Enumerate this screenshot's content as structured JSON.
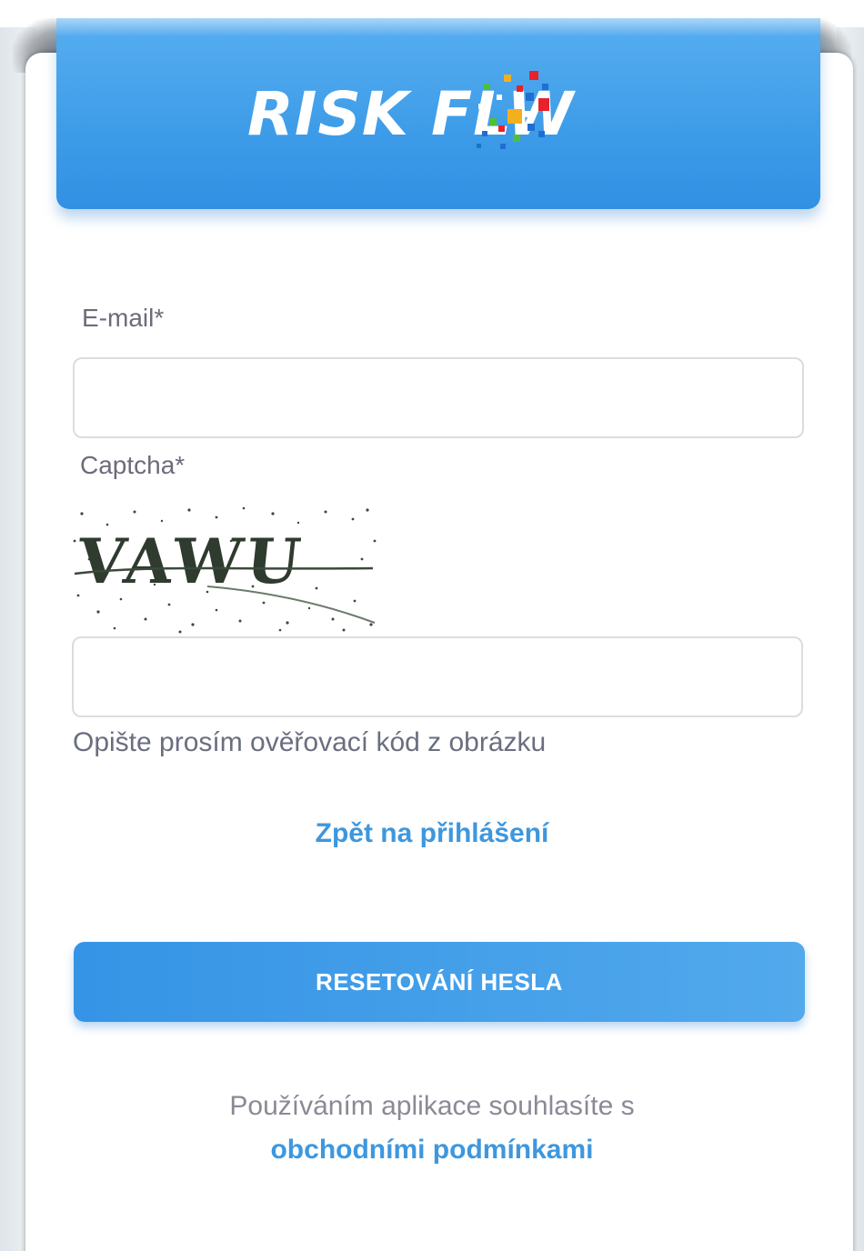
{
  "brand": {
    "logo_text": "RISK FLW",
    "logo_icon": "pixel-mosaic-o-icon",
    "header_color": "#3d9ce8"
  },
  "form": {
    "email_label": "E-mail*",
    "email_value": "",
    "captcha_label": "Captcha*",
    "captcha_image_text": "VAWU",
    "captcha_value": "",
    "captcha_hint": "Opište prosím ověřovací kód z obrázku"
  },
  "links": {
    "back_to_login": "Zpět na přihlášení"
  },
  "actions": {
    "reset_button": "RESETOVÁNÍ HESLA",
    "accent_color": "#3e97de"
  },
  "footer": {
    "terms_text": "Používáním aplikace souhlasíte s",
    "terms_link": "obchodními podmínkami"
  }
}
